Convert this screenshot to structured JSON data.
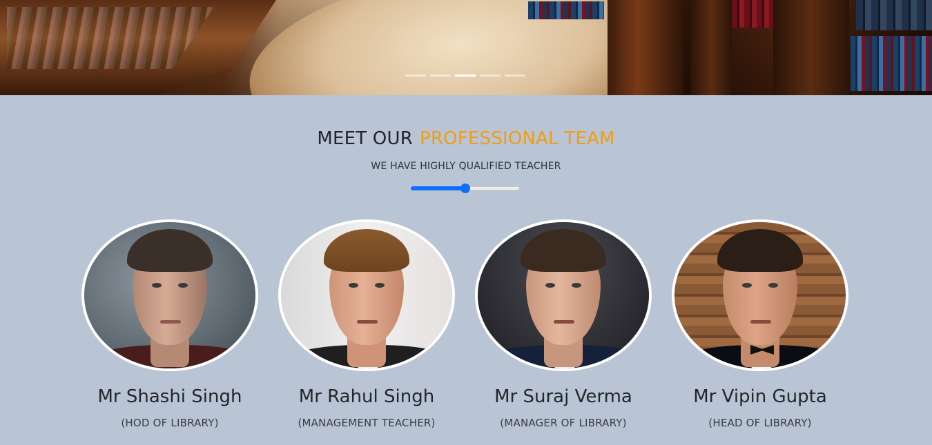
{
  "carousel": {
    "slide_count": 5,
    "active_index": 2
  },
  "section": {
    "title_main": "MEET OUR",
    "title_accent": "PROFESSIONAL TEAM",
    "subtitle": "WE HAVE HIGHLY QUALIFIED TEACHER",
    "accent_color": "#f39c12",
    "slider_value_fraction": 0.5,
    "slider_color": "#0d6efd"
  },
  "team": [
    {
      "name": "Mr Shashi Singh",
      "role": "(HOD OF LIBRARY)"
    },
    {
      "name": "Mr Rahul Singh",
      "role": "(MANAGEMENT TEACHER)"
    },
    {
      "name": "Mr Suraj Verma",
      "role": "(MANAGER OF LIBRARY)"
    },
    {
      "name": "Mr Vipin Gupta",
      "role": "(HEAD OF LIBRARY)"
    }
  ],
  "colors": {
    "background": "#b9c4d4",
    "text": "#23262b"
  }
}
